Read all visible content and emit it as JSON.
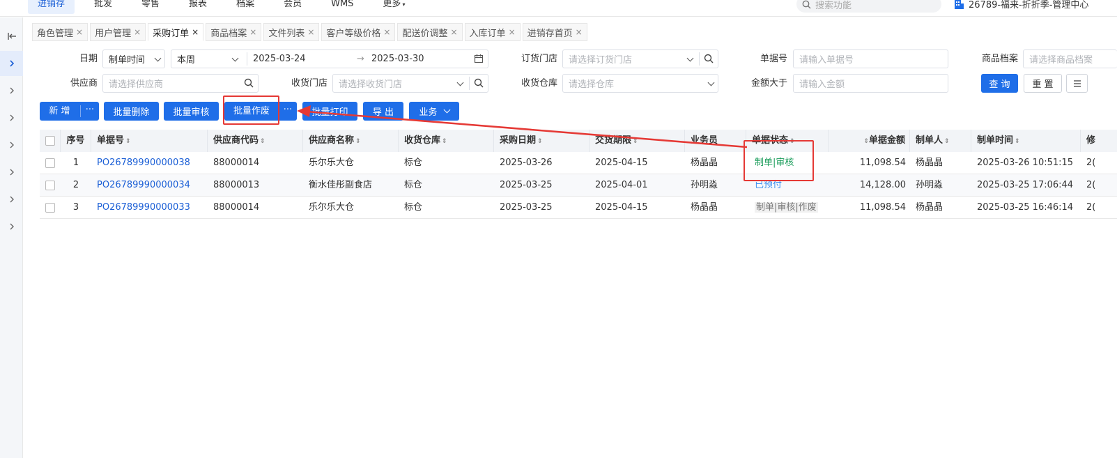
{
  "topnav": {
    "items": [
      "进销存",
      "批发",
      "零售",
      "报表",
      "档案",
      "会员",
      "WMS",
      "更多"
    ],
    "more_caret": "▾",
    "search_placeholder": "搜索功能",
    "company": "26789-福来-折折季-管理中心"
  },
  "tabs": [
    {
      "label": "角色管理"
    },
    {
      "label": "用户管理"
    },
    {
      "label": "采购订单"
    },
    {
      "label": "商品档案"
    },
    {
      "label": "文件列表"
    },
    {
      "label": "客户等级价格"
    },
    {
      "label": "配送价调整"
    },
    {
      "label": "入库订单"
    },
    {
      "label": "进销存首页"
    }
  ],
  "tab_close": "×",
  "filters": {
    "date_label": "日期",
    "date_type": "制单时间",
    "date_range": "本周",
    "date_start": "2025-03-24",
    "date_arrow": "→",
    "date_end": "2025-03-30",
    "order_store_label": "订货门店",
    "order_store_ph": "请选择订货门店",
    "doc_no_label": "单据号",
    "doc_no_ph": "请输入单据号",
    "product_label": "商品档案",
    "product_ph": "请选择商品档案",
    "supplier_label": "供应商",
    "supplier_ph": "请选择供应商",
    "recv_store_label": "收货门店",
    "recv_store_ph": "请选择收货门店",
    "recv_wh_label": "收货仓库",
    "recv_wh_ph": "请选择仓库",
    "amount_label": "金额大于",
    "amount_ph": "请输入金额",
    "query": "查 询",
    "reset": "重 置"
  },
  "actions": {
    "add": "新 增",
    "more": "···",
    "batch_delete": "批量删除",
    "batch_audit": "批量审核",
    "batch_void": "批量作废",
    "batch_print": "批量打印",
    "export": "导 出",
    "business": "业务"
  },
  "table": {
    "headers": [
      "序号",
      "单据号",
      "供应商代码",
      "供应商名称",
      "收货仓库",
      "采购日期",
      "交货期限",
      "业务员",
      "单据状态",
      "单据金额",
      "制单人",
      "制单时间",
      "修"
    ],
    "rows": [
      {
        "idx": "1",
        "no": "PO26789990000038",
        "code": "88000014",
        "name": "乐尔乐大仓",
        "wh": "标仓",
        "date": "2025-03-26",
        "due": "2025-04-15",
        "sales": "杨晶晶",
        "status": "制单|审核",
        "status_kind": "green",
        "amount": "11,098.54",
        "maker": "杨晶晶",
        "time": "2025-03-26 10:51:15",
        "tail": "2("
      },
      {
        "idx": "2",
        "no": "PO26789990000034",
        "code": "88000013",
        "name": "衡水佳彤副食店",
        "wh": "标仓",
        "date": "2025-03-25",
        "due": "2025-04-01",
        "sales": "孙明淼",
        "status": "已预付",
        "status_kind": "blue",
        "amount": "14,128.00",
        "maker": "孙明淼",
        "time": "2025-03-25 17:06:44",
        "tail": "2("
      },
      {
        "idx": "3",
        "no": "PO26789990000033",
        "code": "88000014",
        "name": "乐尔乐大仓",
        "wh": "标仓",
        "date": "2025-03-25",
        "due": "2025-04-15",
        "sales": "杨晶晶",
        "status": "制单|审核|作废",
        "status_kind": "gray",
        "amount": "11,098.54",
        "maker": "杨晶晶",
        "time": "2025-03-25 16:46:14",
        "tail": "2("
      }
    ]
  },
  "colors": {
    "primary": "#1f6ee8",
    "link": "#1b5fd6",
    "highlight": "#e53935",
    "status_green": "#1a9c5a",
    "status_blue": "#3b8ff0"
  }
}
